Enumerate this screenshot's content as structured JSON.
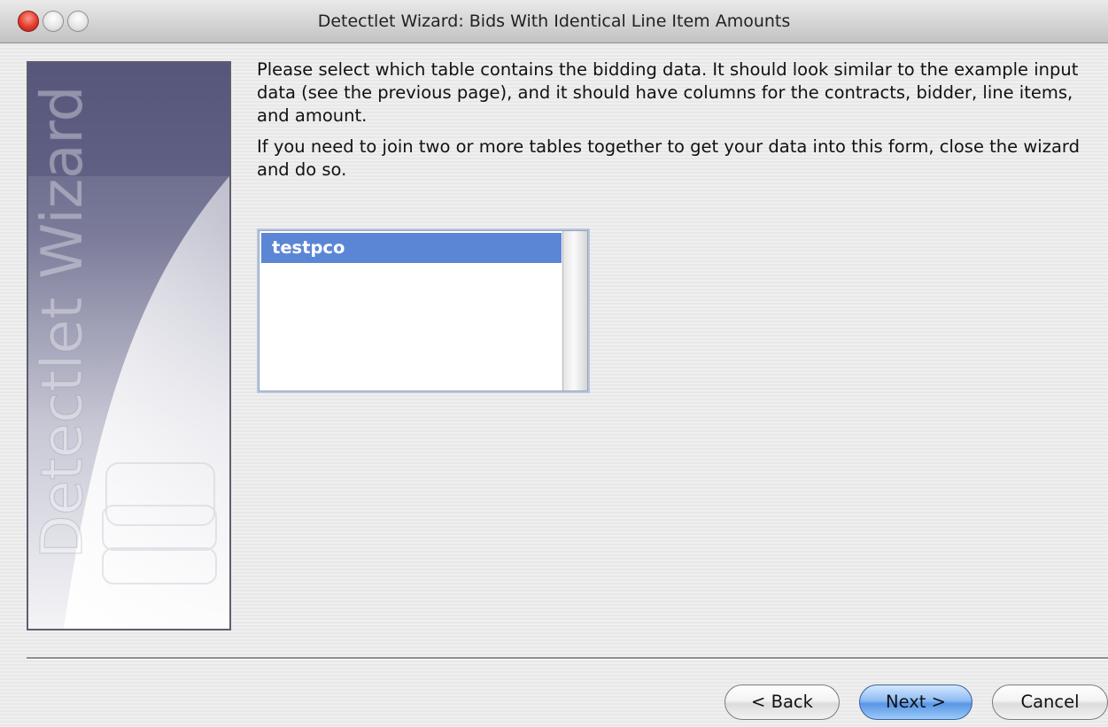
{
  "window": {
    "title": "Detectlet Wizard: Bids With Identical Line Item Amounts"
  },
  "sidebar": {
    "banner_text": "Detectlet Wizard",
    "colors": {
      "top": "#5a5a7e",
      "fade": "#e6e6ee"
    }
  },
  "instructions": {
    "paragraph1": "Please select which table contains the bidding data. It should look similar to the example input data (see the previous page), and it should have columns for the contracts, bidder, line items, and amount.",
    "paragraph2": "If you need to join two or more tables together to get your data into this form, close the wizard and do so."
  },
  "table_list": {
    "items": [
      {
        "label": "testpco",
        "selected": true
      }
    ],
    "selection_color": "#5b86d6"
  },
  "buttons": {
    "back": "< Back",
    "next": "Next >",
    "cancel": "Cancel"
  },
  "icons": {
    "close": "close-button",
    "minimize": "minimize-button",
    "zoom": "zoom-button",
    "sidebar_art": "database-stack-icon"
  }
}
